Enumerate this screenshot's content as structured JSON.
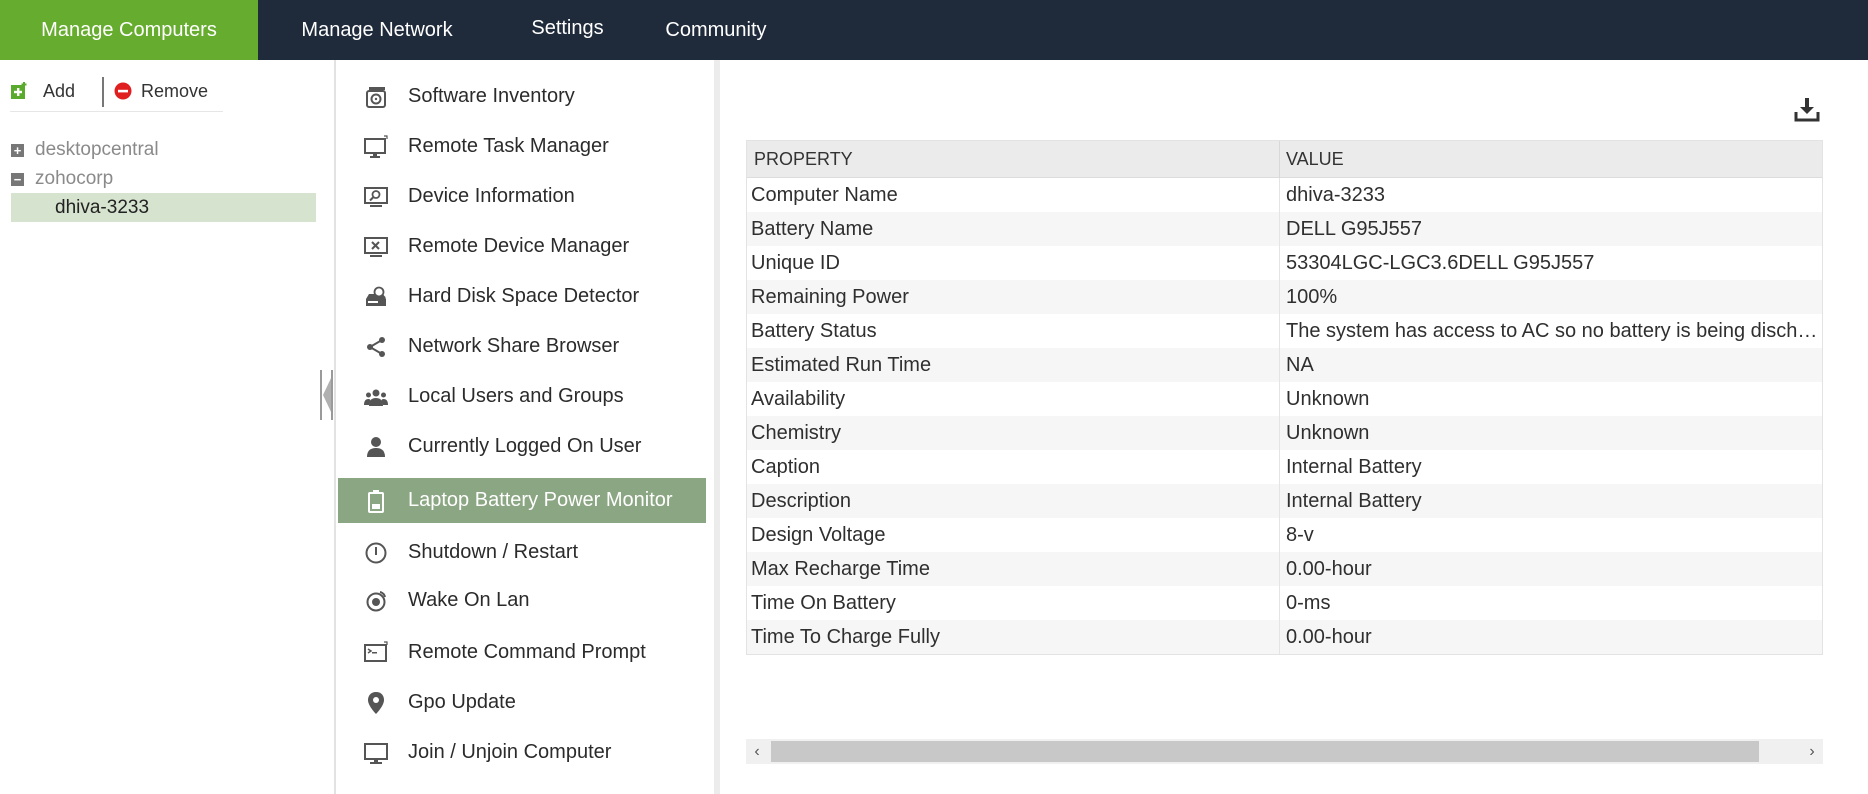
{
  "nav": {
    "tabs": [
      {
        "label": "Manage Computers"
      },
      {
        "label": "Manage Network"
      },
      {
        "label": "Settings"
      },
      {
        "label": "Community"
      }
    ]
  },
  "toolbar": {
    "add_label": "Add",
    "remove_label": "Remove"
  },
  "tree": {
    "nodes": [
      {
        "label": "desktopcentral",
        "toggle": "+"
      },
      {
        "label": "zohocorp",
        "toggle": "−"
      }
    ],
    "selected_leaf": "dhiva-3233"
  },
  "tools": [
    {
      "label": "Software Inventory",
      "icon": "software-icon"
    },
    {
      "label": "Remote Task Manager",
      "icon": "monitor-icon"
    },
    {
      "label": "Device Information",
      "icon": "device-info-icon"
    },
    {
      "label": "Remote Device Manager",
      "icon": "device-manager-icon"
    },
    {
      "label": "Hard Disk Space Detector",
      "icon": "disk-icon"
    },
    {
      "label": "Network Share Browser",
      "icon": "share-icon"
    },
    {
      "label": "Local Users and Groups",
      "icon": "users-icon"
    },
    {
      "label": "Currently Logged On User",
      "icon": "user-icon"
    },
    {
      "label": "Laptop Battery Power Monitor",
      "icon": "battery-icon"
    },
    {
      "label": "Shutdown / Restart",
      "icon": "power-icon"
    },
    {
      "label": "Wake On Lan",
      "icon": "wake-icon"
    },
    {
      "label": "Remote Command Prompt",
      "icon": "terminal-icon"
    },
    {
      "label": "Gpo Update",
      "icon": "location-pin-icon"
    },
    {
      "label": "Join / Unjoin Computer",
      "icon": "computer-icon"
    }
  ],
  "active_tool": "Laptop Battery Power Monitor",
  "grid": {
    "headers": [
      "PROPERTY",
      "VALUE"
    ],
    "rows": [
      [
        "Computer Name",
        "dhiva-3233"
      ],
      [
        "Battery Name",
        "DELL G95J557"
      ],
      [
        "Unique ID",
        "53304LGC-LGC3.6DELL G95J557"
      ],
      [
        "Remaining Power",
        "100%"
      ],
      [
        "Battery Status",
        "The system has access to AC so no battery is being discharged"
      ],
      [
        "Estimated Run Time",
        "NA"
      ],
      [
        "Availability",
        "Unknown"
      ],
      [
        "Chemistry",
        "Unknown"
      ],
      [
        "Caption",
        "Internal Battery"
      ],
      [
        "Description",
        "Internal Battery"
      ],
      [
        "Design Voltage",
        "8-v"
      ],
      [
        "Max Recharge Time",
        "0.00-hour"
      ],
      [
        "Time On Battery",
        "0-ms"
      ],
      [
        "Time To Charge Fully",
        "0.00-hour"
      ]
    ]
  },
  "colors": {
    "topbar": "#1f2a3b",
    "active_tab": "#66ac2e",
    "active_tool": "#8ba682",
    "selected_leaf": "#d6e3cf"
  }
}
